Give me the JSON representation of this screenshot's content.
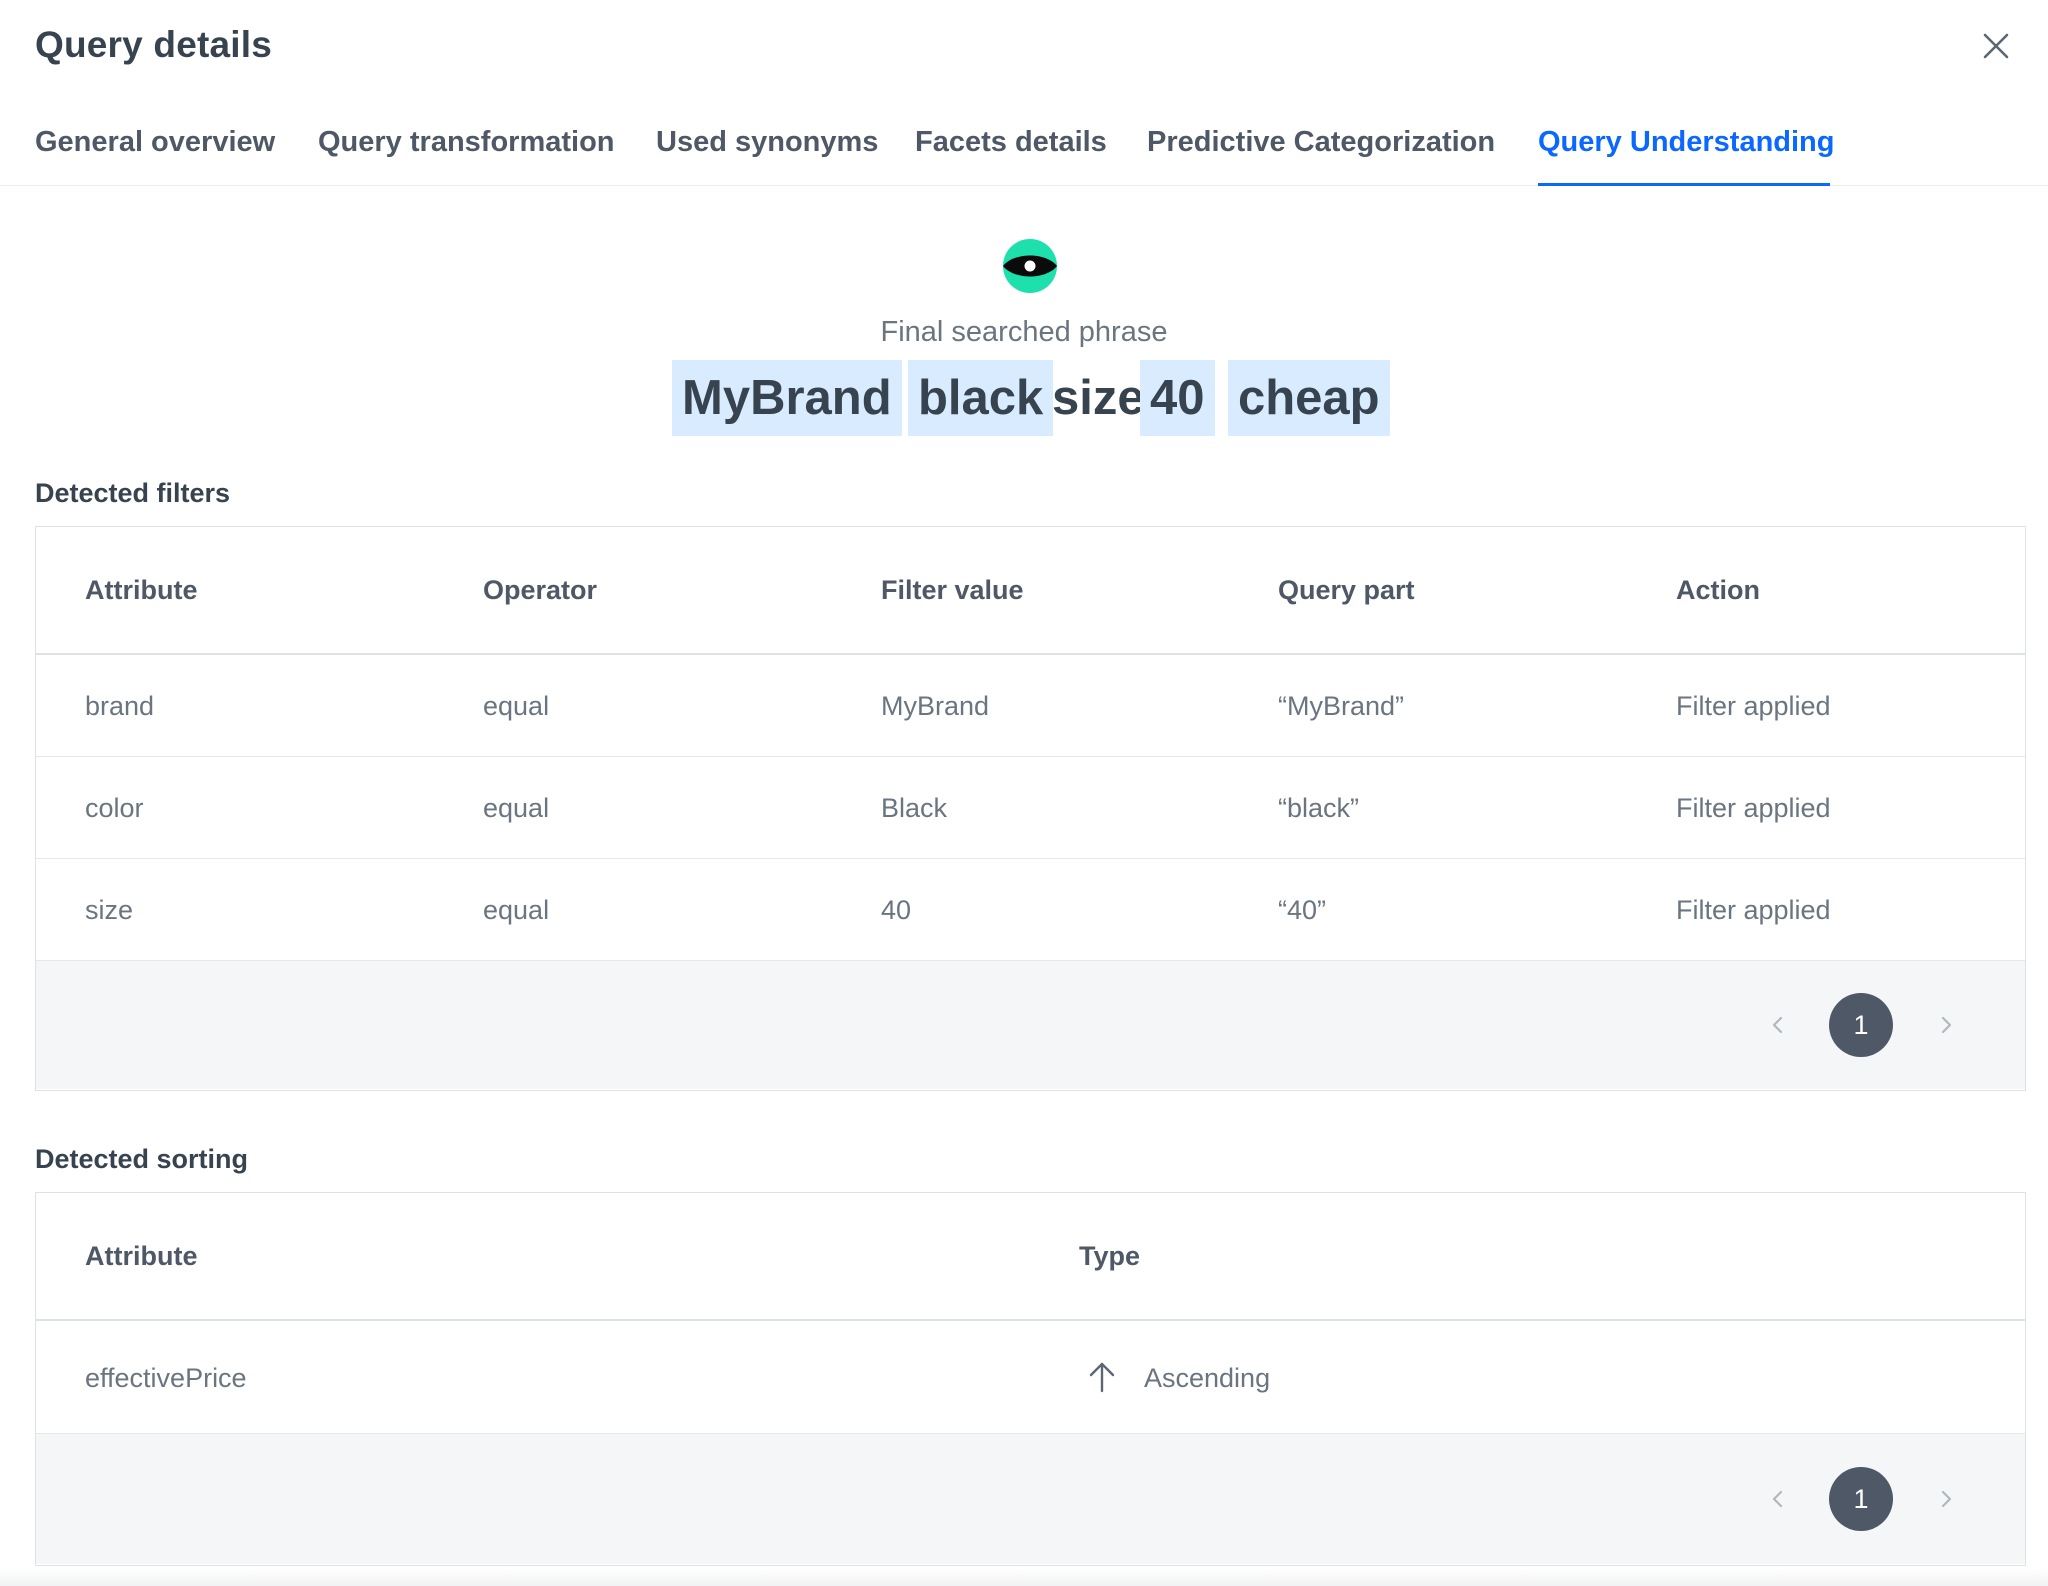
{
  "modal": {
    "title": "Query details"
  },
  "tabs": [
    {
      "label": "General overview",
      "active": false
    },
    {
      "label": "Query transformation",
      "active": false
    },
    {
      "label": "Used synonyms",
      "active": false
    },
    {
      "label": "Facets details",
      "active": false
    },
    {
      "label": "Predictive Categorization",
      "active": false
    },
    {
      "label": "Query Understanding",
      "active": true
    }
  ],
  "hero": {
    "label": "Final searched phrase",
    "tokens": [
      {
        "text": "MyBrand",
        "highlighted": true
      },
      {
        "text": "black",
        "highlighted": true
      },
      {
        "text": "size",
        "highlighted": false
      },
      {
        "text": "40",
        "highlighted": true
      },
      {
        "text": "cheap",
        "highlighted": true
      }
    ]
  },
  "filters": {
    "title": "Detected filters",
    "columns": [
      "Attribute",
      "Operator",
      "Filter value",
      "Query part",
      "Action"
    ],
    "rows": [
      [
        "brand",
        "equal",
        "MyBrand",
        "“MyBrand”",
        "Filter applied"
      ],
      [
        "color",
        "equal",
        "Black",
        "“black”",
        "Filter applied"
      ],
      [
        "size",
        "equal",
        "40",
        "“40”",
        "Filter applied"
      ]
    ],
    "pagination": {
      "current_page": "1"
    }
  },
  "sorting": {
    "title": "Detected sorting",
    "columns": [
      "Attribute",
      "Type"
    ],
    "rows": [
      {
        "attribute": "effectivePrice",
        "type": "Ascending"
      }
    ],
    "pagination": {
      "current_page": "1"
    }
  },
  "colors": {
    "accent": "#0b68ff",
    "highlight": "#d9ecff",
    "eye_green": "#1de0ad",
    "pager_active": "#4e5866"
  },
  "icons": {
    "close": "close-icon",
    "eye": "eye-icon",
    "prev": "chevron-left-icon",
    "next": "chevron-right-icon",
    "sort": "arrow-up-icon"
  }
}
